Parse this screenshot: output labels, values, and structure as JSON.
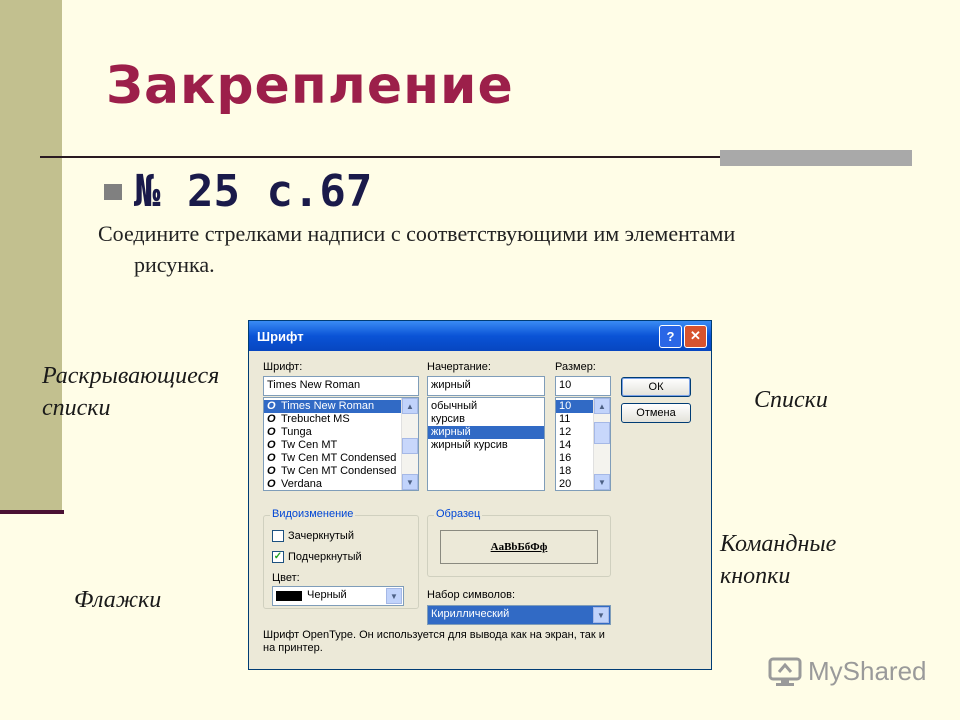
{
  "slide": {
    "title": "Закрепление",
    "subheading": "№ 25 с.67",
    "instruction_line1": "Соедините стрелками надписи с соответствующими им элементами",
    "instruction_line2": "рисунка.",
    "labels": {
      "dropdown_lists": "Раскрывающиеся списки",
      "lists": "Списки",
      "command_buttons": "Командные кнопки",
      "checkboxes": "Флажки"
    },
    "watermark": "MyShared"
  },
  "dialog": {
    "title": "Шрифт",
    "help_glyph": "?",
    "close_glyph": "✕",
    "font": {
      "label": "Шрифт:",
      "value": "Times New Roman",
      "items": [
        "Times New Roman",
        "Trebuchet MS",
        "Tunga",
        "Tw Cen MT",
        "Tw Cen MT Condensed",
        "Tw Cen MT Condensed",
        "Verdana"
      ],
      "selected_index": 0
    },
    "style": {
      "label": "Начертание:",
      "value": "жирный",
      "items": [
        "обычный",
        "курсив",
        "жирный",
        "жирный курсив"
      ],
      "selected_index": 2
    },
    "size": {
      "label": "Размер:",
      "value": "10",
      "items": [
        "10",
        "11",
        "12",
        "14",
        "16",
        "18",
        "20"
      ],
      "selected_index": 0
    },
    "buttons": {
      "ok": "ОК",
      "cancel": "Отмена"
    },
    "effects": {
      "title": "Видоизменение",
      "strikeout": "Зачеркнутый",
      "underline": "Подчеркнутый",
      "color_label": "Цвет:",
      "color_value": "Черный",
      "color_swatch": "#000000"
    },
    "sample": {
      "title": "Образец",
      "text": "AaBbБбФф"
    },
    "charset": {
      "label": "Набор символов:",
      "value": "Кириллический"
    },
    "description": "Шрифт OpenType. Он используется для вывода как на экран, так и на принтер."
  },
  "colors": {
    "title": "#9c1f4a",
    "titlebar": "#0a53d6",
    "selection": "#316ac5"
  }
}
